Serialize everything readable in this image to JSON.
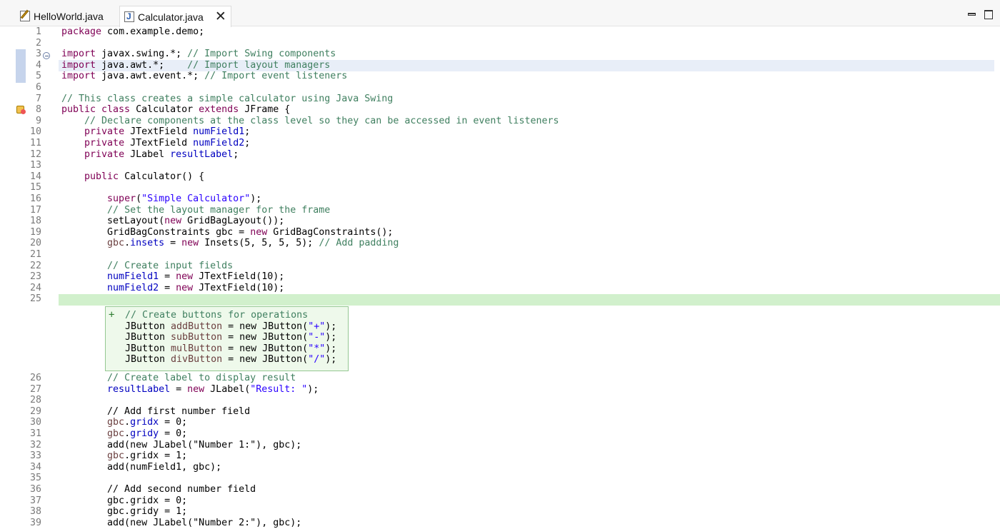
{
  "tabs": [
    {
      "label": "HelloWorld.java"
    },
    {
      "label": "Calculator.java",
      "close": "✕"
    }
  ],
  "editor": {
    "lines": [
      {
        "n": "1",
        "y": 0,
        "segs": [
          [
            "kw",
            "package"
          ],
          [
            "t",
            " com.example.demo;"
          ]
        ]
      },
      {
        "n": "2",
        "y": 0,
        "segs": []
      },
      {
        "n": "3",
        "y": 0,
        "segs": [
          [
            "kw",
            "import"
          ],
          [
            "t",
            " javax.swing.*; "
          ],
          [
            "cm",
            "// Import Swing components"
          ]
        ]
      },
      {
        "n": "4",
        "y": 0,
        "segs": [
          [
            "kw",
            "import"
          ],
          [
            "t",
            " java.awt.*;    "
          ],
          [
            "cm",
            "// Import layout managers"
          ]
        ]
      },
      {
        "n": "5",
        "y": 0,
        "segs": [
          [
            "kw",
            "import"
          ],
          [
            "t",
            " java.awt.event.*; "
          ],
          [
            "cm",
            "// Import event listeners"
          ]
        ]
      },
      {
        "n": "6",
        "y": 0,
        "segs": []
      },
      {
        "n": "7",
        "y": 0,
        "segs": [
          [
            "cm",
            "// This class creates a simple calculator using Java Swing"
          ]
        ]
      },
      {
        "n": "8",
        "y": 0,
        "segs": [
          [
            "kw",
            "public class"
          ],
          [
            "t",
            " Calculator "
          ],
          [
            "kw",
            "extends"
          ],
          [
            "t",
            " JFrame {"
          ]
        ]
      },
      {
        "n": "9",
        "y": 0,
        "segs": [
          [
            "t",
            "    "
          ],
          [
            "cm",
            "// Declare components at the class level so they can be accessed in event listeners"
          ]
        ]
      },
      {
        "n": "10",
        "y": 0,
        "segs": [
          [
            "t",
            "    "
          ],
          [
            "kw",
            "private"
          ],
          [
            "t",
            " JTextField "
          ],
          [
            "fld",
            "numField1"
          ],
          [
            "t",
            ";"
          ]
        ]
      },
      {
        "n": "11",
        "y": 0,
        "segs": [
          [
            "t",
            "    "
          ],
          [
            "kw",
            "private"
          ],
          [
            "t",
            " JTextField "
          ],
          [
            "fld",
            "numField2"
          ],
          [
            "t",
            ";"
          ]
        ]
      },
      {
        "n": "12",
        "y": 0,
        "segs": [
          [
            "t",
            "    "
          ],
          [
            "kw",
            "private"
          ],
          [
            "t",
            " JLabel "
          ],
          [
            "fld",
            "resultLabel"
          ],
          [
            "t",
            ";"
          ]
        ]
      },
      {
        "n": "13",
        "y": 0,
        "segs": []
      },
      {
        "n": "14",
        "y": 0,
        "segs": [
          [
            "t",
            "    "
          ],
          [
            "kw",
            "public"
          ],
          [
            "t",
            " Calculator() {"
          ]
        ]
      },
      {
        "n": "15",
        "y": 0,
        "segs": []
      },
      {
        "n": "16",
        "y": 0,
        "segs": [
          [
            "t",
            "        "
          ],
          [
            "kw",
            "super"
          ],
          [
            "t",
            "("
          ],
          [
            "str",
            "\"Simple Calculator\""
          ],
          [
            "t",
            ");"
          ]
        ]
      },
      {
        "n": "17",
        "y": 0,
        "segs": [
          [
            "t",
            "        "
          ],
          [
            "cm",
            "// Set the layout manager for the frame"
          ]
        ]
      },
      {
        "n": "18",
        "y": 0,
        "segs": [
          [
            "t",
            "        setLayout("
          ],
          [
            "kw",
            "new"
          ],
          [
            "t",
            " GridBagLayout());"
          ]
        ]
      },
      {
        "n": "19",
        "y": 0,
        "segs": [
          [
            "t",
            "        GridBagConstraints gbc = "
          ],
          [
            "kw",
            "new"
          ],
          [
            "t",
            " GridBagConstraints();"
          ]
        ]
      },
      {
        "n": "20",
        "y": 0,
        "segs": [
          [
            "t",
            "        "
          ],
          [
            "loc",
            "gbc"
          ],
          [
            "t",
            "."
          ],
          [
            "fld",
            "insets"
          ],
          [
            "t",
            " = "
          ],
          [
            "kw",
            "new"
          ],
          [
            "t",
            " Insets(5, 5, 5, 5); "
          ],
          [
            "cm",
            "// Add padding"
          ]
        ]
      },
      {
        "n": "21",
        "y": 0,
        "segs": []
      },
      {
        "n": "22",
        "y": 0,
        "segs": [
          [
            "t",
            "        "
          ],
          [
            "cm",
            "// Create input fields"
          ]
        ]
      },
      {
        "n": "23",
        "y": 0,
        "segs": [
          [
            "t",
            "        "
          ],
          [
            "fld",
            "numField1"
          ],
          [
            "t",
            " = "
          ],
          [
            "kw",
            "new"
          ],
          [
            "t",
            " JTextField(10);"
          ]
        ]
      },
      {
        "n": "24",
        "y": 0,
        "segs": [
          [
            "t",
            "        "
          ],
          [
            "fld",
            "numField2"
          ],
          [
            "t",
            " = "
          ],
          [
            "kw",
            "new"
          ],
          [
            "t",
            " JTextField(10);"
          ]
        ]
      },
      {
        "n": "25",
        "y": 0,
        "segs": []
      },
      {
        "n": "26",
        "y": 0,
        "segs": [
          [
            "t",
            "        "
          ],
          [
            "cm",
            "// Create label to display result"
          ]
        ]
      },
      {
        "n": "27",
        "y": 0,
        "segs": [
          [
            "t",
            "        "
          ],
          [
            "fld",
            "resultLabel"
          ],
          [
            "t",
            " = "
          ],
          [
            "kw",
            "new"
          ],
          [
            "t",
            " JLabel("
          ],
          [
            "str",
            "\"Result: \""
          ],
          [
            "t",
            ");"
          ]
        ]
      },
      {
        "n": "28",
        "y": 0,
        "segs": []
      },
      {
        "n": "29",
        "y": 0,
        "segs": [
          [
            "t",
            "        // Add first number field"
          ]
        ]
      },
      {
        "n": "30",
        "y": 0,
        "segs": [
          [
            "t",
            "        "
          ],
          [
            "loc",
            "gbc"
          ],
          [
            "t",
            "."
          ],
          [
            "fld",
            "gridx"
          ],
          [
            "t",
            " = 0;"
          ]
        ]
      },
      {
        "n": "31",
        "y": 0,
        "segs": [
          [
            "t",
            "        "
          ],
          [
            "loc",
            "gbc"
          ],
          [
            "t",
            "."
          ],
          [
            "fld",
            "gridy"
          ],
          [
            "t",
            " = 0;"
          ]
        ]
      },
      {
        "n": "32",
        "y": 0,
        "segs": [
          [
            "t",
            "        add(new JLabel(\"Number 1:\"), gbc);"
          ]
        ]
      },
      {
        "n": "33",
        "y": 0,
        "segs": [
          [
            "t",
            "        "
          ],
          [
            "loc",
            "gbc"
          ],
          [
            "t",
            ".gridx = 1;"
          ]
        ]
      },
      {
        "n": "34",
        "y": 0,
        "segs": [
          [
            "t",
            "        add(numField1, gbc);"
          ]
        ]
      },
      {
        "n": "35",
        "y": 0,
        "segs": []
      },
      {
        "n": "36",
        "y": 0,
        "segs": [
          [
            "t",
            "        // Add second number field"
          ]
        ]
      },
      {
        "n": "37",
        "y": 0,
        "segs": [
          [
            "t",
            "        gbc.gridx = 0;"
          ]
        ]
      },
      {
        "n": "38",
        "y": 0,
        "segs": [
          [
            "t",
            "        gbc.gridy = 1;"
          ]
        ]
      },
      {
        "n": "39",
        "y": 0,
        "segs": [
          [
            "t",
            "        add(new JLabel(\"Number 2:\"), gbc);"
          ]
        ]
      }
    ],
    "suggestion": {
      "plus": "+",
      "lines": [
        [
          [
            "cm",
            "// Create buttons for operations"
          ]
        ],
        [
          [
            "t",
            "JButton "
          ],
          [
            "loc",
            "addButton"
          ],
          [
            "t",
            " = new JButton("
          ],
          [
            "str",
            "\"+\""
          ],
          [
            "t",
            ");"
          ]
        ],
        [
          [
            "t",
            "JButton "
          ],
          [
            "loc",
            "subButton"
          ],
          [
            "t",
            " = new JButton("
          ],
          [
            "str",
            "\"-\""
          ],
          [
            "t",
            ");"
          ]
        ],
        [
          [
            "t",
            "JButton "
          ],
          [
            "loc",
            "mulButton"
          ],
          [
            "t",
            " = new JButton("
          ],
          [
            "str",
            "\"*\""
          ],
          [
            "t",
            ");"
          ]
        ],
        [
          [
            "t",
            "JButton "
          ],
          [
            "loc",
            "divButton"
          ],
          [
            "t",
            " = new JButton("
          ],
          [
            "str",
            "\"/\""
          ],
          [
            "t",
            ");"
          ]
        ]
      ]
    }
  },
  "colors": {
    "keyword": "#7f0055",
    "string": "#2a00ff",
    "comment": "#3f7f5f",
    "field": "#0000c0",
    "suggestion_bg": "#eef9eb",
    "added_line_bg": "#d1f0cc"
  }
}
